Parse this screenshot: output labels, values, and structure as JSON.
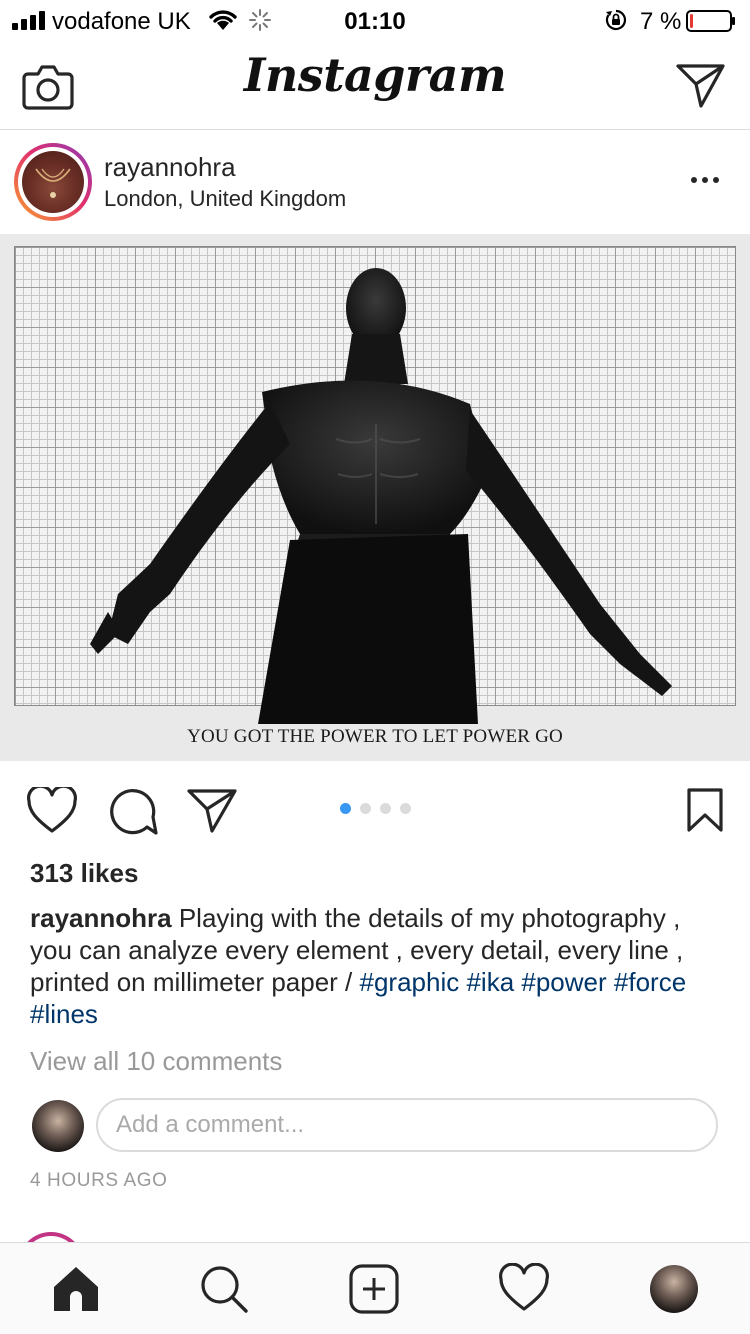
{
  "status_bar": {
    "carrier": "vodafone UK",
    "time": "01:10",
    "battery_percent": "7 %",
    "battery_level": 0.07,
    "battery_color": "#e53935"
  },
  "nav": {
    "logo": "Instagram",
    "left_icon": "camera-icon",
    "right_icon": "direct-message-icon"
  },
  "post": {
    "username": "rayannohra",
    "location": "London, United Kingdom",
    "menu_icon": "more-options-icon",
    "image_text": "YOU GOT THE POWER TO LET POWER GO",
    "carousel": {
      "count": 4,
      "active_index": 0,
      "active_color": "#3897f0"
    },
    "likes": "313 likes",
    "caption": {
      "user": "rayannohra",
      "text": " Playing with the details of my photography , you can analyze every element , every detail, every line , printed on millimeter paper / ",
      "hashtags": [
        "#graphic",
        "#ika",
        "#power",
        "#force",
        "#lines"
      ]
    },
    "view_comments": "View all 10 comments",
    "comment_placeholder": "Add a comment...",
    "timestamp": "4 HOURS AGO"
  },
  "tabbar": {
    "items": [
      "home-icon",
      "search-icon",
      "add-post-icon",
      "activity-heart-icon",
      "profile-avatar"
    ]
  }
}
